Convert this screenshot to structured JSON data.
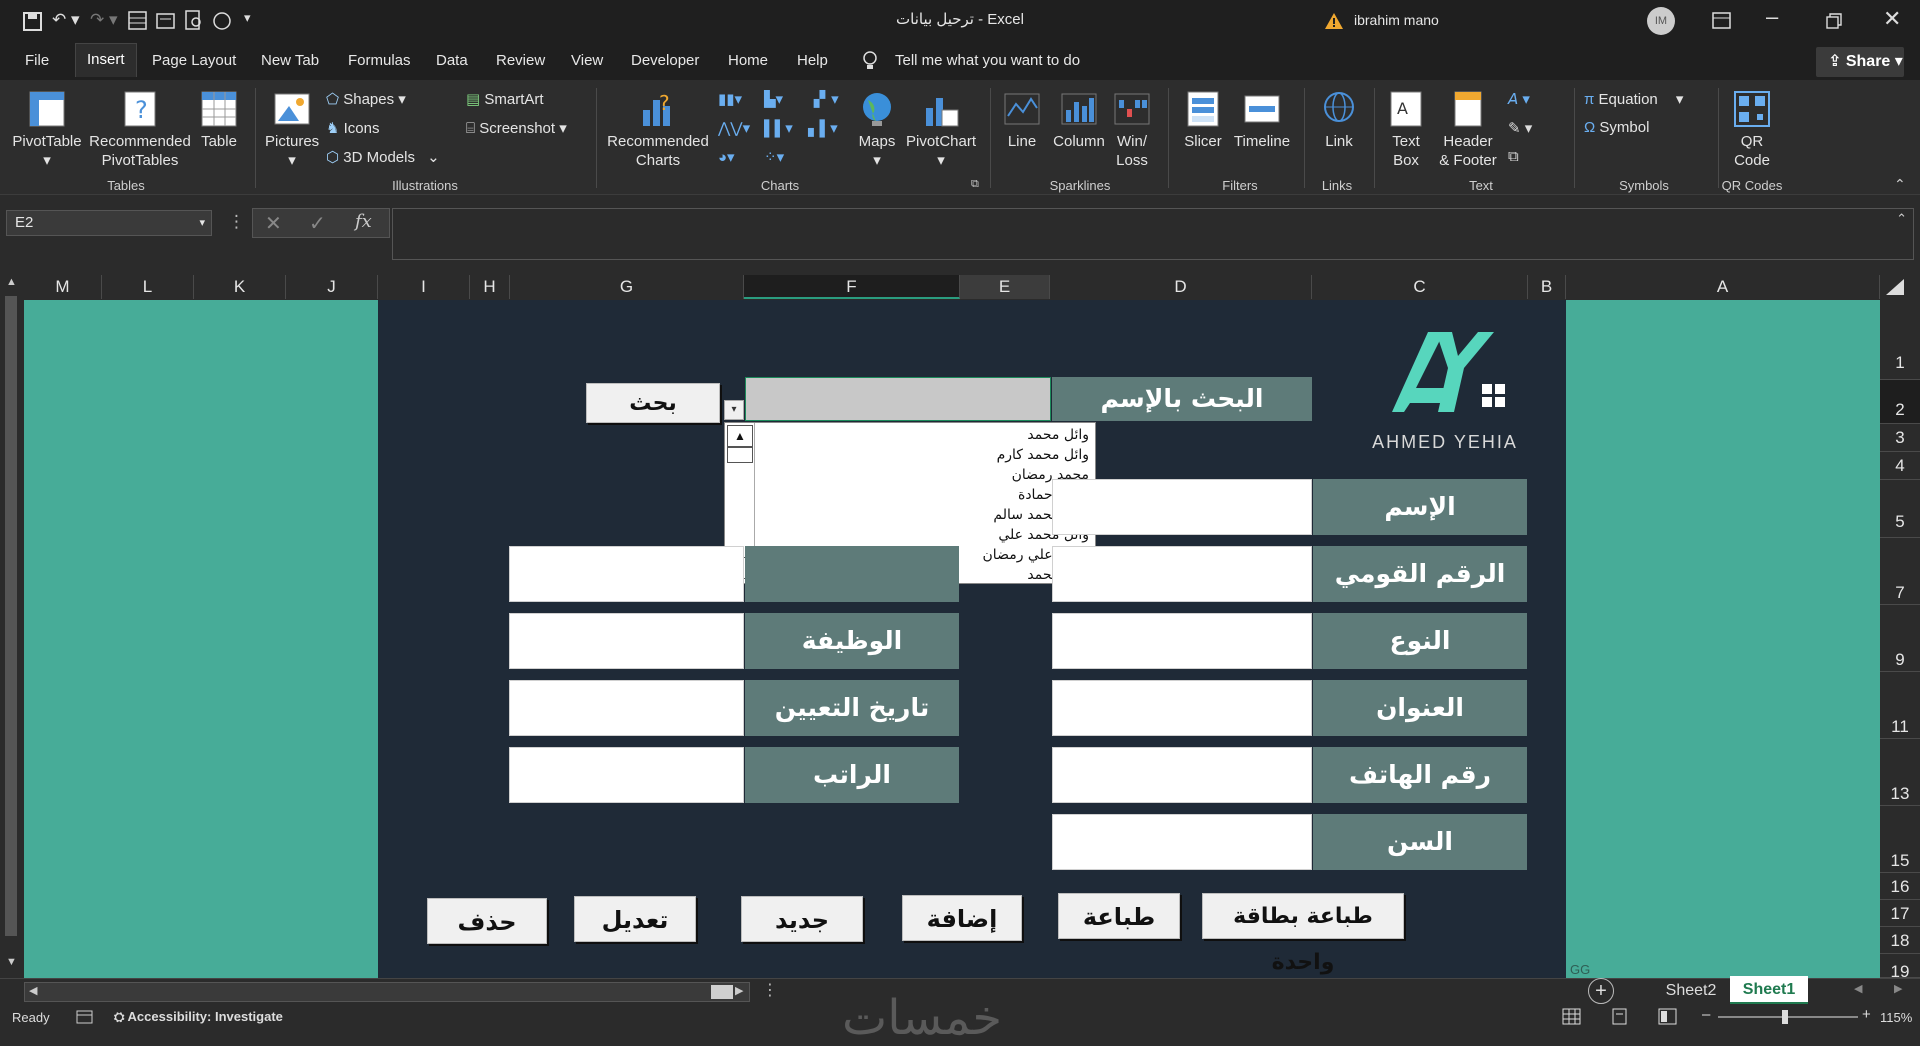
{
  "window": {
    "title": "ترحيل بيانات  -  Excel",
    "user": "ibrahim mano",
    "user_initials": "IM",
    "share_label": "Share"
  },
  "menu": {
    "tabs": [
      "File",
      "Insert",
      "Page Layout",
      "New Tab",
      "Formulas",
      "Data",
      "Review",
      "View",
      "Developer",
      "Home",
      "Help"
    ],
    "active": "Insert",
    "tell_me": "Tell me what you want to do"
  },
  "ribbon": {
    "tables": {
      "pivottable": "PivotTable",
      "recommended": "Recommended",
      "pivottables": "PivotTables",
      "table": "Table",
      "group": "Tables"
    },
    "illustrations": {
      "pictures": "Pictures",
      "shapes": "Shapes",
      "icons": "Icons",
      "models": "3D Models",
      "smartart": "SmartArt",
      "screenshot": "Screenshot",
      "group": "Illustrations"
    },
    "charts": {
      "recommended": "Recommended",
      "charts": "Charts",
      "maps": "Maps",
      "pivotchart": "PivotChart",
      "group": "Charts"
    },
    "sparklines": {
      "line": "Line",
      "column": "Column",
      "win": "Win/",
      "loss": "Loss",
      "group": "Sparklines"
    },
    "filters": {
      "slicer": "Slicer",
      "timeline": "Timeline",
      "group": "Filters"
    },
    "links": {
      "link": "Link",
      "group": "Links"
    },
    "text": {
      "text": "Text",
      "box": "Box",
      "header": "Header",
      "footer": "& Footer",
      "group": "Text"
    },
    "symbols": {
      "equation": "Equation",
      "symbol": "Symbol",
      "group": "Symbols"
    },
    "qr": {
      "qr": "QR",
      "code": "Code",
      "group": "QR Codes"
    }
  },
  "formula_bar": {
    "name_box": "E2",
    "fx": "fx",
    "value": ""
  },
  "columns": [
    "M",
    "L",
    "K",
    "J",
    "I",
    "H",
    "G",
    "F",
    "E",
    "D",
    "C",
    "B",
    "A"
  ],
  "rows": [
    "1",
    "2",
    "3",
    "4",
    "5",
    "7",
    "9",
    "11",
    "13",
    "15",
    "16",
    "17",
    "18",
    "19"
  ],
  "form": {
    "logo_text": "AHMED YEHIA",
    "search_label": "البحث بالإسم",
    "search_button": "بحث",
    "labels_right": [
      "الإسم",
      "الرقم القومي",
      "النوع",
      "العنوان",
      "رقم الهاتف",
      "السن"
    ],
    "labels_left": [
      "الوظيفة",
      "تاريخ التعيين",
      "الراتب"
    ],
    "buttons": [
      "حذف",
      "تعديل",
      "جديد",
      "إضافة",
      "طباعة",
      "طباعة بطاقة واحدة"
    ],
    "dropdown_items": [
      "وائل محمد",
      "وائل محمد كارم",
      "محمد  رمضان",
      "محمد حمادة",
      "وائل محمد سالم",
      "وائل محمد علي",
      "محمد علي رمضان",
      "وائل محمد"
    ],
    "corner_text": "GG"
  },
  "sheets": {
    "tabs": [
      "Sheet2",
      "Sheet1"
    ],
    "active": "Sheet1"
  },
  "status": {
    "ready": "Ready",
    "accessibility": "Accessibility: Investigate",
    "zoom": "115%",
    "watermark": "خمسات"
  },
  "colors": {
    "teal": "#47ac98",
    "navy": "#1f2a37",
    "label_bg": "#5e7b79",
    "accent_logo": "#57d6bd"
  }
}
